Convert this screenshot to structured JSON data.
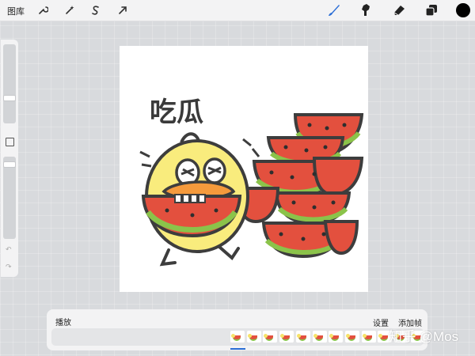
{
  "topbar": {
    "gallery_label": "图库",
    "left_tools": [
      {
        "icon": "wrench-icon"
      },
      {
        "icon": "magic-wand-icon"
      },
      {
        "icon": "selection-s-icon"
      },
      {
        "icon": "transform-arrow-icon"
      }
    ],
    "right_tools": [
      {
        "icon": "brush-icon"
      },
      {
        "icon": "smudge-icon"
      },
      {
        "icon": "eraser-icon"
      },
      {
        "icon": "layers-icon"
      },
      {
        "icon": "color-circle-icon"
      }
    ],
    "accent_color": "#2b6ed6",
    "active_color": "#000000"
  },
  "sidebar": {
    "brush_size_level": 0.7,
    "opacity_level": 0.55,
    "undo_glyph": "↶",
    "redo_glyph": "↷"
  },
  "canvas": {
    "drawing_text": "吃瓜"
  },
  "animation": {
    "play_label": "播放",
    "settings_label": "设置",
    "add_frame_label": "添加帧",
    "frame_count": 12,
    "selected_frame": 0
  },
  "watermark": {
    "text": "知乎 @Mos"
  }
}
